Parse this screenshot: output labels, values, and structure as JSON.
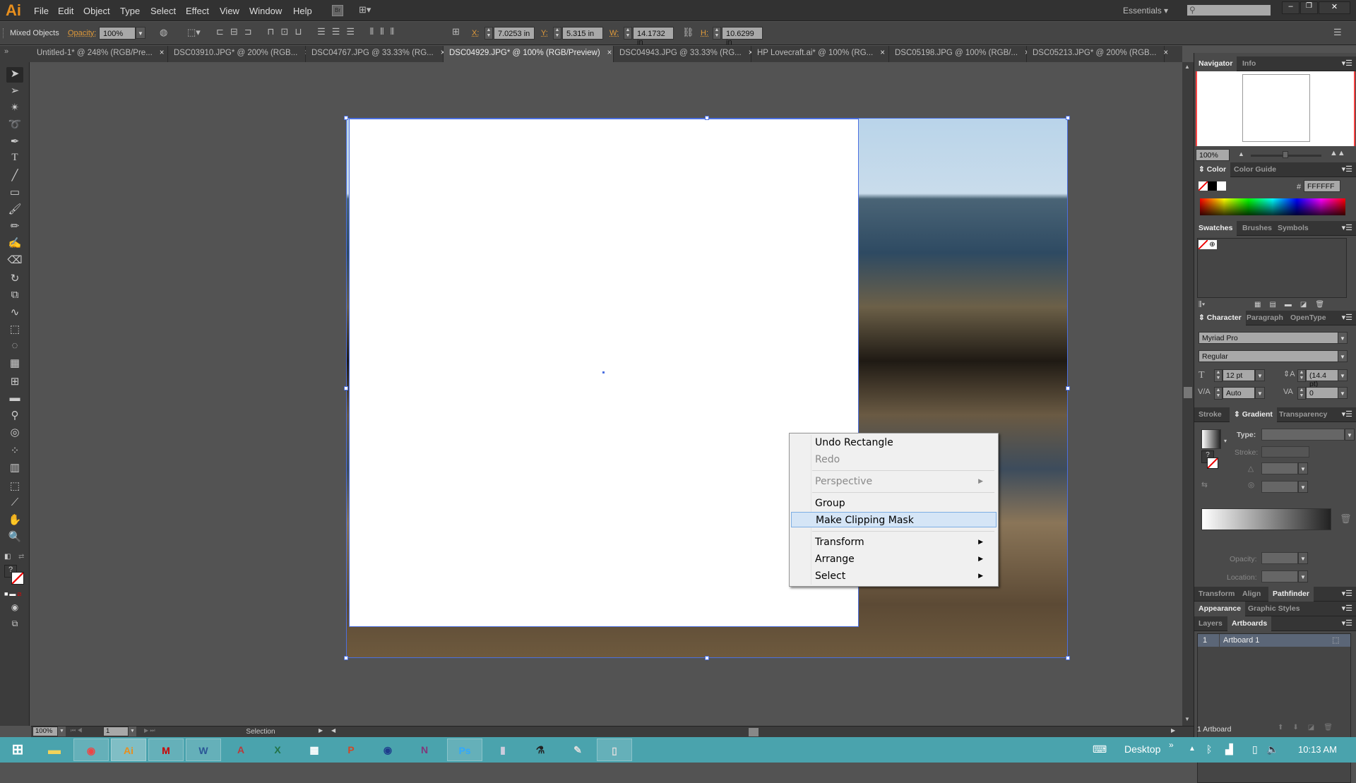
{
  "app": {
    "logo": "Ai"
  },
  "menu": [
    "File",
    "Edit",
    "Object",
    "Type",
    "Select",
    "Effect",
    "View",
    "Window",
    "Help"
  ],
  "workspace": {
    "label": "Essentials",
    "search_placeholder": ""
  },
  "control_bar": {
    "selection_label": "Mixed Objects",
    "opacity_label": "Opacity:",
    "opacity_value": "100%",
    "x_label": "X:",
    "x_value": "7.0253 in",
    "y_label": "Y:",
    "y_value": "5.315 in",
    "w_label": "W:",
    "w_value": "14.1732 in",
    "h_label": "H:",
    "h_value": "10.6299 in"
  },
  "tabs": [
    {
      "label": "Untitled-1* @ 248% (RGB/Pre..."
    },
    {
      "label": "DSC03910.JPG* @ 200% (RGB..."
    },
    {
      "label": "DSC04767.JPG @ 33.33% (RG..."
    },
    {
      "label": "DSC04929.JPG* @ 100% (RGB/Preview)",
      "active": true
    },
    {
      "label": "DSC04943.JPG @ 33.33% (RG..."
    },
    {
      "label": "HP Lovecraft.ai* @ 100% (RG..."
    },
    {
      "label": "DSC05198.JPG @ 100% (RGB/..."
    },
    {
      "label": "DSC05213.JPG* @ 200% (RGB..."
    }
  ],
  "tab_close": "×",
  "context_menu": {
    "items": [
      {
        "label": "Undo Rectangle",
        "enabled": true
      },
      {
        "label": "Redo",
        "enabled": false
      },
      {
        "label": "Perspective",
        "enabled": false,
        "submenu": true
      },
      {
        "label": "Group",
        "enabled": true
      },
      {
        "label": "Make Clipping Mask",
        "enabled": true,
        "highlighted": true
      },
      {
        "label": "Transform",
        "enabled": true,
        "submenu": true
      },
      {
        "label": "Arrange",
        "enabled": true,
        "submenu": true
      },
      {
        "label": "Select",
        "enabled": true,
        "submenu": true
      }
    ],
    "arrow": "▶"
  },
  "panels": {
    "navigator": {
      "tabs": [
        "Navigator",
        "Info"
      ],
      "zoom": "100%"
    },
    "color": {
      "tabs": [
        "Color",
        "Color Guide"
      ],
      "hash": "#",
      "hex": "FFFFFF"
    },
    "swatches": {
      "tabs": [
        "Swatches",
        "Brushes",
        "Symbols"
      ]
    },
    "character": {
      "tabs": [
        "Character",
        "Paragraph",
        "OpenType"
      ],
      "font": "Myriad Pro",
      "style": "Regular",
      "size": "12 pt",
      "leading": "(14.4 pt)",
      "kerning": "Auto",
      "tracking": "0"
    },
    "gradient": {
      "tabs": [
        "Stroke",
        "Gradient",
        "Transparency"
      ],
      "type_label": "Type:",
      "stroke_label": "Stroke:",
      "opacity_label": "Opacity:",
      "location_label": "Location:"
    },
    "transform": {
      "tabs": [
        "Transform",
        "Align",
        "Pathfinder"
      ]
    },
    "appearance": {
      "tabs": [
        "Appearance",
        "Graphic Styles"
      ]
    },
    "artboards": {
      "tabs": [
        "Layers",
        "Artboards"
      ],
      "rows": [
        {
          "num": "1",
          "name": "Artboard 1"
        }
      ],
      "footer": "1 Artboard"
    }
  },
  "status_bar": {
    "zoom": "100%",
    "page": "1",
    "tool": "Selection"
  },
  "taskbar": {
    "apps": [
      "Start",
      "File Explorer",
      "Chrome",
      "Illustrator",
      "Mendeley",
      "Word",
      "Access",
      "Excel",
      "Apps",
      "PowerPoint",
      "Maps",
      "OneNote",
      "Photoshop",
      "Notepad",
      "Microscope",
      "Pen",
      "Snipping"
    ],
    "desktop_label": "Desktop",
    "clock": "10:13 AM"
  }
}
